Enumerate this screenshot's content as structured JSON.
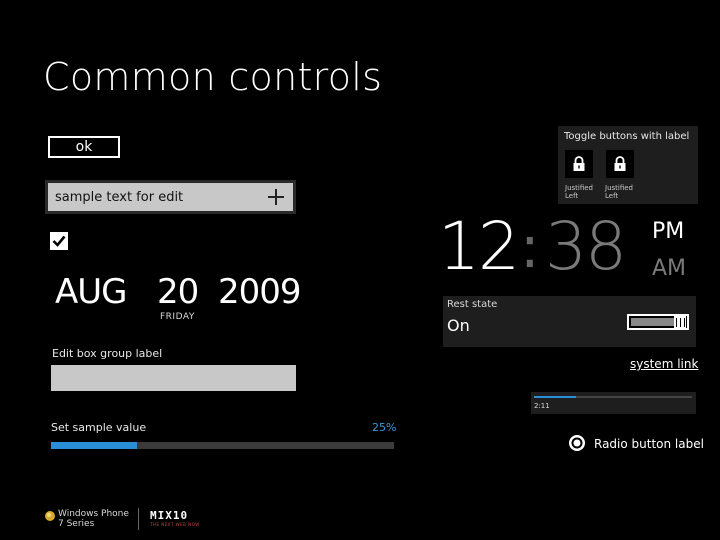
{
  "page": {
    "title": "Common controls"
  },
  "button": {
    "label": "ok"
  },
  "edit": {
    "value": "sample text for edit"
  },
  "checkbox": {
    "checked": true
  },
  "date": {
    "month": "AUG",
    "day": "20",
    "year": "2009",
    "weekday": "FRIDAY"
  },
  "group": {
    "label": "Edit box group label",
    "value": ""
  },
  "slider": {
    "label": "Set sample value",
    "value_text": "25%",
    "value": 0.25
  },
  "toggles": {
    "title": "Toggle buttons with label",
    "left_label_1": "Justified",
    "left_label_2": "Left",
    "right_label_1": "Justified",
    "right_label_2": "Left"
  },
  "clock": {
    "hours": "12",
    "colon": ":",
    "minutes": "38",
    "pm": "PM",
    "am": "AM"
  },
  "rest": {
    "label": "Rest state",
    "value": "On"
  },
  "link": {
    "label": "system link"
  },
  "media": {
    "time": "2:11",
    "progress": 0.26
  },
  "radio": {
    "label": "Radio button label"
  },
  "footer": {
    "wp_line1": "Windows Phone",
    "wp_line2": "7 Series",
    "mix_logo": "MIX10",
    "mix_tag": "THE NEXT WEB NOW"
  },
  "colors": {
    "accent": "#2a8fd6",
    "background": "#000000",
    "control": "#c8c8c8"
  }
}
